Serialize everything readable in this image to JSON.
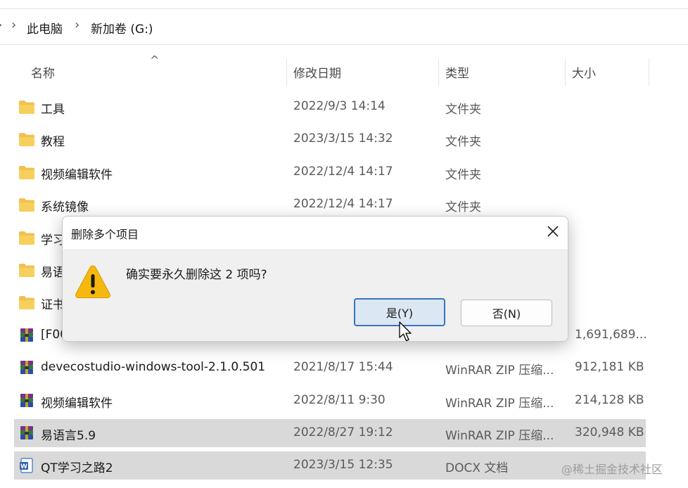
{
  "breadcrumb": {
    "root": "此电脑",
    "drive": "新加卷 (G:)"
  },
  "columns": {
    "name": "名称",
    "date": "修改日期",
    "type": "类型",
    "size": "大小"
  },
  "files": [
    {
      "name": "工具",
      "date": "2022/9/3 14:14",
      "type": "文件夹",
      "size": "",
      "icon": "folder-icon",
      "selected": false
    },
    {
      "name": "教程",
      "date": "2023/3/15 14:32",
      "type": "文件夹",
      "size": "",
      "icon": "folder-icon",
      "selected": false
    },
    {
      "name": "视频编辑软件",
      "date": "2022/12/4 14:17",
      "type": "文件夹",
      "size": "",
      "icon": "folder-icon",
      "selected": false
    },
    {
      "name": "系统镜像",
      "date": "2022/12/4 14:17",
      "type": "文件夹",
      "size": "",
      "icon": "folder-icon",
      "selected": false
    },
    {
      "name": "学习",
      "date": "",
      "type": "",
      "size": "",
      "icon": "folder-icon",
      "selected": false
    },
    {
      "name": "易语",
      "date": "",
      "type": "",
      "size": "",
      "icon": "folder-icon",
      "selected": false
    },
    {
      "name": "证书",
      "date": "",
      "type": "",
      "size": "",
      "icon": "folder-icon",
      "selected": false
    },
    {
      "name": "[F00",
      "date": "",
      "type": "",
      "size": "1,691,689...",
      "icon": "winrar-icon",
      "selected": false
    },
    {
      "name": "devecostudio-windows-tool-2.1.0.501",
      "date": "2021/8/17 15:44",
      "type": "WinRAR ZIP 压缩...",
      "size": "912,181 KB",
      "icon": "winrar-icon",
      "selected": false
    },
    {
      "name": "视频编辑软件",
      "date": "2022/8/11 9:30",
      "type": "WinRAR ZIP 压缩...",
      "size": "214,128 KB",
      "icon": "winrar-icon",
      "selected": false
    },
    {
      "name": "易语言5.9",
      "date": "2022/8/27 19:12",
      "type": "WinRAR ZIP 压缩...",
      "size": "320,948 KB",
      "icon": "winrar-icon",
      "selected": true
    },
    {
      "name": "QT学习之路2",
      "date": "2023/3/15 12:35",
      "type": "DOCX 文档",
      "size": "",
      "icon": "word-doc-icon",
      "selected": true
    }
  ],
  "dialog": {
    "title": "删除多个项目",
    "message": "确实要永久删除这 2 项吗?",
    "yes_label": "是(Y)",
    "no_label": "否(N)",
    "icon": "warning-icon"
  },
  "watermark": "@稀土掘金技术社区",
  "colors": {
    "accent": "#3b73c4",
    "folder": "#f2c14e",
    "warning": "#f6b80f",
    "selection": "#d9d9d9"
  }
}
